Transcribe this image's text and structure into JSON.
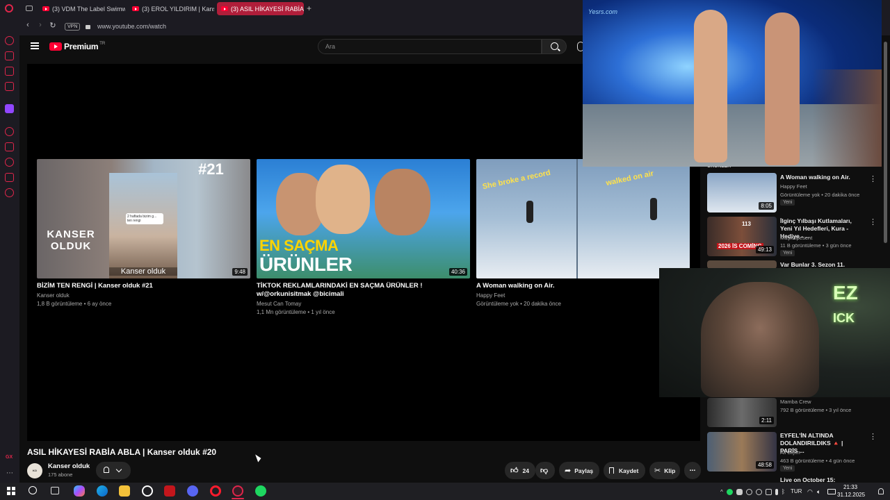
{
  "browser": {
    "tabs": [
      {
        "label": "(3) VDM The Label Swimw"
      },
      {
        "label": "(3) EROL YILDIRIM | Kanse"
      },
      {
        "label": "(3) ASIL HİKAYESİ RABİA A"
      }
    ],
    "vpn_badge": "VPN",
    "url": "www.youtube.com/watch",
    "sidebar_bottom_label": "GX"
  },
  "youtube": {
    "logo_text": "Premium",
    "logo_region": "TR",
    "search_placeholder": "Ara"
  },
  "end_screen": [
    {
      "title": "BİZİM TEN RENGİ | Kanser olduk #21",
      "channel": "Kanser olduk",
      "meta": "1,8 B görüntüleme • 6 ay önce",
      "duration": "9:48",
      "thumb_text_top": "#21",
      "thumb_text_logo": "KANSER OLDUK",
      "thumb_caption": "Kanser olduk",
      "thumb_sticker": "2 haftada bizim g...\nten rengi"
    },
    {
      "title": "TİKTOK REKLAMLARINDAKİ EN SAÇMA ÜRÜNLER ! w/@orkunisitmak @bicimali",
      "channel": "Mesut Can Tomay",
      "meta": "1,1 Mn görüntüleme • 1 yıl önce",
      "duration": "40:36",
      "thumb_text_line1": "EN SAÇMA",
      "thumb_text_line2": "ÜRÜNLER"
    },
    {
      "title": "A Woman walking on Air.",
      "channel": "Happy Feet",
      "meta": "Görüntüleme yok • 20 dakika önce",
      "thumb_text_left": "She broke a record",
      "thumb_text_right": "walked on air"
    }
  ],
  "video": {
    "title": "ASIL HİKAYESİ RABİA ABLA | Kanser olduk #20",
    "channel": "Kanser olduk",
    "subscribers": "175 abone",
    "likes": "24",
    "share_label": "Paylaş",
    "save_label": "Kaydet",
    "clip_label": "Klip"
  },
  "related": [
    {
      "title": "A Woman walking on Air.",
      "channel": "Happy Feet",
      "meta": "Görüntüleme yok • 20 dakika önce",
      "badge": "Yeni",
      "duration": "8:05"
    },
    {
      "title": "İlginç Yılbaşı Kutlamaları, Yeni Yıl Hedefleri, Kura - Hediye - ...",
      "channel": "Müşkülpesent",
      "meta": "11 B görüntüleme • 3 gün önce",
      "badge": "Yeni",
      "duration": "49:13",
      "thumb_text": "2026 İS COMİNG",
      "thumb_text_alt": "113"
    },
    {
      "title": "Var Bunlar 3. Sezon 11. Bölüm"
    },
    {
      "channel": "Mamba Crew",
      "meta": "792 B görüntüleme • 3 yıl önce",
      "duration": "2:11"
    },
    {
      "title": "EYFEL'İN ALTINDA DOLANDIRILDIKS 🔺 | PARİS ...",
      "channel": "Ali Biçim",
      "meta": "463 B görüntüleme • 4 gün önce",
      "badge": "Yeni",
      "duration": "48:58"
    },
    {
      "title": "Live on October 15: Victoria's ..."
    }
  ],
  "related_partial_top": "URUNLER",
  "pip": {
    "watermark": "Yesrs.com"
  },
  "webcam": {
    "neon_line1": "EZ",
    "neon_line2": "ICK"
  },
  "taskbar": {
    "language": "TUR",
    "time": "21:33",
    "date": "31.12.2025"
  },
  "colors": {
    "opera_red": "#e0264b",
    "yt_red": "#ff0033",
    "active_tab": "#b01e3a"
  }
}
